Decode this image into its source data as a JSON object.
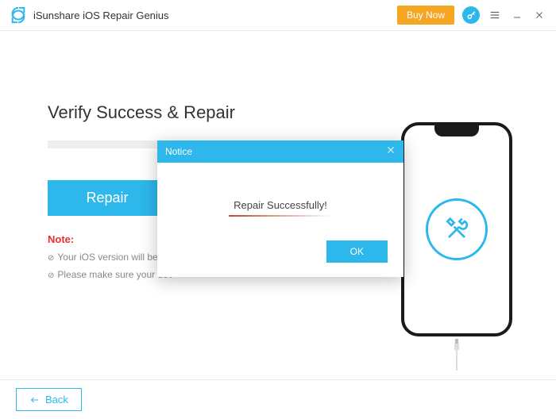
{
  "titlebar": {
    "app_name": "iSunshare iOS Repair Genius",
    "buy_now": "Buy Now"
  },
  "main": {
    "heading": "Verify Success & Repair",
    "repair_button": "Repair",
    "note_label": "Note:",
    "note_line1": "Your iOS version will be upd",
    "note_line2": "Please make sure your dev"
  },
  "modal": {
    "title": "Notice",
    "message": "Repair Successfully!",
    "ok": "OK"
  },
  "footer": {
    "back": "Back"
  }
}
